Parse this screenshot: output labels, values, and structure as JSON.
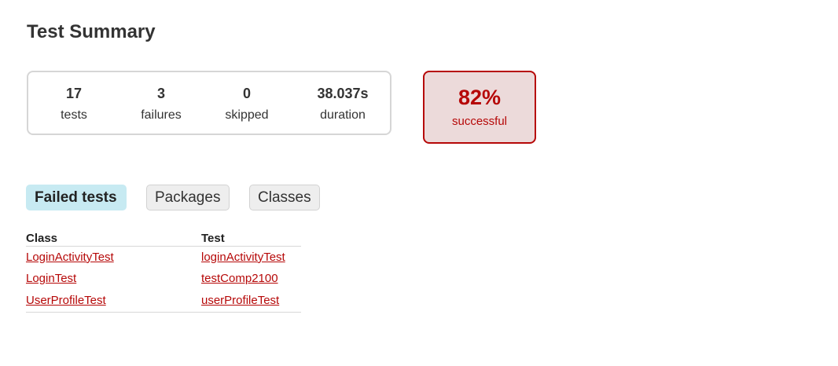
{
  "page": {
    "title": "Test Summary"
  },
  "summary": {
    "tests": {
      "value": "17",
      "label": "tests"
    },
    "failures": {
      "value": "3",
      "label": "failures"
    },
    "skipped": {
      "value": "0",
      "label": "skipped"
    },
    "duration": {
      "value": "38.037s",
      "label": "duration"
    }
  },
  "success": {
    "percent": "82%",
    "label": "successful",
    "color": "#b60808"
  },
  "tabs": [
    {
      "label": "Failed tests",
      "selected": true
    },
    {
      "label": "Packages",
      "selected": false
    },
    {
      "label": "Classes",
      "selected": false
    }
  ],
  "failed_tests": {
    "headers": {
      "class": "Class",
      "test": "Test"
    },
    "rows": [
      {
        "class": "LoginActivityTest",
        "test": "loginActivityTest"
      },
      {
        "class": "LoginTest",
        "test": "testComp2100"
      },
      {
        "class": "UserProfileTest",
        "test": "userProfileTest"
      }
    ]
  }
}
